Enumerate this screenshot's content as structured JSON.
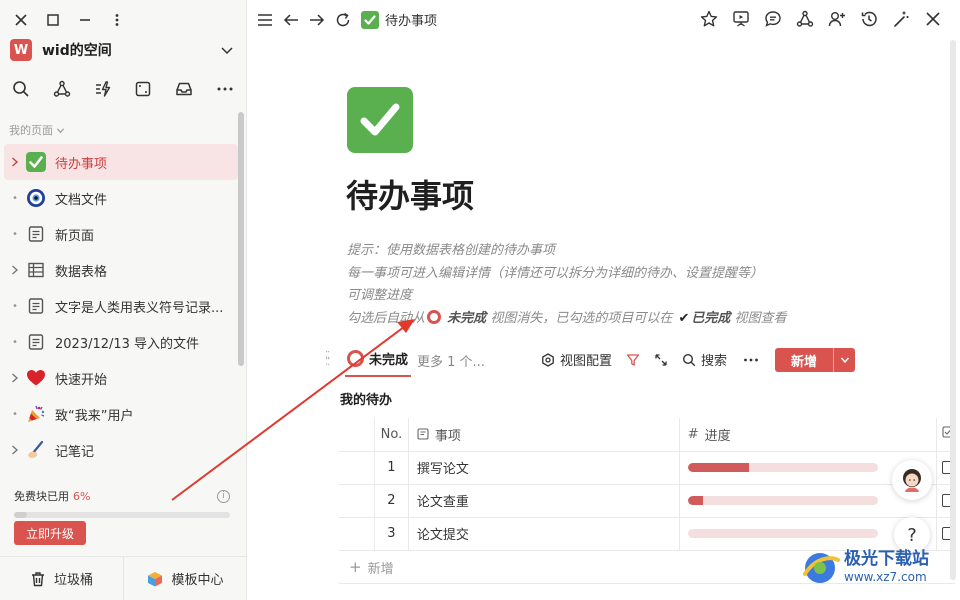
{
  "sidebar": {
    "workspace": {
      "initial": "W",
      "name": "wid的空间"
    },
    "section_label": "我的页面",
    "items": [
      {
        "label": "待办事项",
        "icon": "checkmark-icon",
        "lead": "expand"
      },
      {
        "label": "文档文件",
        "icon": "eye-icon",
        "lead": "dot"
      },
      {
        "label": "新页面",
        "icon": "document-icon",
        "lead": "dot"
      },
      {
        "label": "数据表格",
        "icon": "table-icon",
        "lead": "expand"
      },
      {
        "label": "文字是人类用表义符号记录...",
        "icon": "document-icon",
        "lead": "dot"
      },
      {
        "label": "2023/12/13 导入的文件",
        "icon": "document-icon",
        "lead": "dot"
      },
      {
        "label": "快速开始",
        "icon": "heart-icon",
        "lead": "expand"
      },
      {
        "label": "致“我来”用户",
        "icon": "party-popper-icon",
        "lead": "dot"
      },
      {
        "label": "记笔记",
        "icon": "writing-hand-icon",
        "lead": "expand"
      }
    ],
    "quota": {
      "label": "免费块已用",
      "percent_text": "6%",
      "percent": 6
    },
    "upgrade_label": "立即升级",
    "trash_label": "垃圾桶",
    "templates_label": "模板中心"
  },
  "topbar": {
    "breadcrumb": "待办事项"
  },
  "page": {
    "title": "待办事项",
    "hints": {
      "line1": "提示：使用数据表格创建的待办事项",
      "line2": "每一事项可进入编辑详情（详情还可以拆分为详细的待办、设置提醒等）",
      "line3": "可调整进度",
      "line4_a": "勾选后自动从",
      "line4_b": "未完成",
      "line4_c": "视图消失，已勾选的项目可以在",
      "line4_d": "已完成",
      "line4_e": "视图查看"
    },
    "view": {
      "active_tab": "未完成",
      "more": "更多 1 个...",
      "config": "视图配置",
      "search": "搜索",
      "new": "新增"
    },
    "table": {
      "title": "我的待办",
      "headers": {
        "no": "No.",
        "task": "事项",
        "progress": "进度"
      },
      "rows": [
        {
          "no": "1",
          "task": "撰写论文",
          "progress": 0.32
        },
        {
          "no": "2",
          "task": "论文查重",
          "progress": 0.08
        },
        {
          "no": "3",
          "task": "论文提交",
          "progress": 0
        }
      ],
      "add_row": "新增"
    }
  },
  "watermark": {
    "main": "极光下载站",
    "sub": "www.xz7.com"
  },
  "colors": {
    "accent": "#d9534f",
    "progress": "#d15a5a",
    "icon_green": "#5aaf4f"
  }
}
